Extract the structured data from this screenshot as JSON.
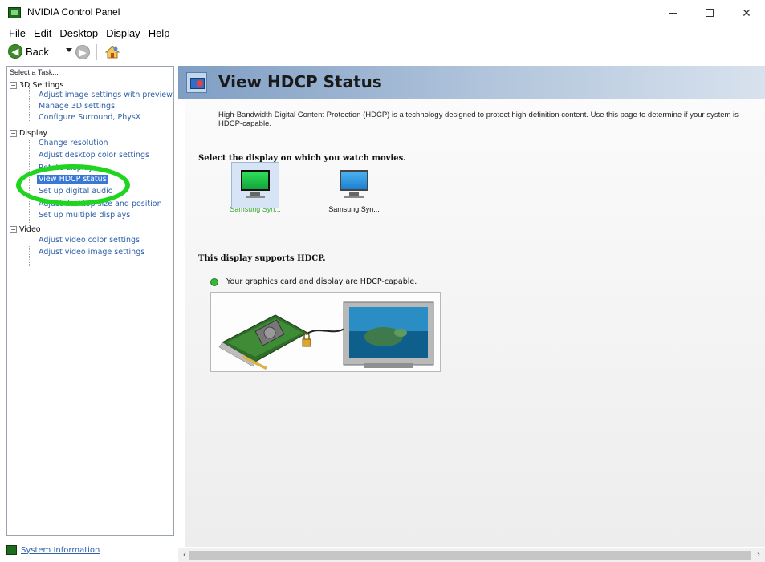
{
  "window": {
    "title": "NVIDIA Control Panel",
    "minimize_icon": "minimize-icon",
    "maximize_icon": "maximize-icon",
    "close_label": "✕"
  },
  "menu": [
    "File",
    "Edit",
    "Desktop",
    "Display",
    "Help"
  ],
  "toolbar": {
    "back_label": "Back",
    "back_icon": "back-arrow-icon",
    "forward_icon": "forward-arrow-icon",
    "home_icon": "home-icon"
  },
  "tasks": {
    "header": "Select a Task...",
    "categories": [
      {
        "label": "3D Settings",
        "items": [
          "Adjust image settings with preview",
          "Manage 3D settings",
          "Configure Surround, PhysX"
        ]
      },
      {
        "label": "Display",
        "items": [
          "Change resolution",
          "Adjust desktop color settings",
          "Rotate display",
          "View HDCP status",
          "Set up digital audio",
          "Adjust desktop size and position",
          "Set up multiple displays"
        ]
      },
      {
        "label": "Video",
        "items": [
          "Adjust video color settings",
          "Adjust video image settings"
        ]
      }
    ],
    "selected": "View HDCP status",
    "system_information": "System Information"
  },
  "content": {
    "title": "View HDCP Status",
    "description": "High-Bandwidth Digital Content Protection (HDCP) is a technology designed to protect high-definition content. Use this page to determine if your system is HDCP-capable.",
    "select_display_label": "Select the display on which you watch movies.",
    "displays": [
      {
        "label": "Samsung Syn...",
        "selected": true
      },
      {
        "label": "Samsung Syn...",
        "selected": false
      }
    ],
    "support_label": "This display supports HDCP.",
    "status_text": "Your graphics card and display are HDCP-capable."
  },
  "colors": {
    "accent_green": "#1fd51f",
    "link_blue": "#2d5fa8",
    "selection_blue": "#3a78d6",
    "header_band": "#7f9ec4"
  }
}
